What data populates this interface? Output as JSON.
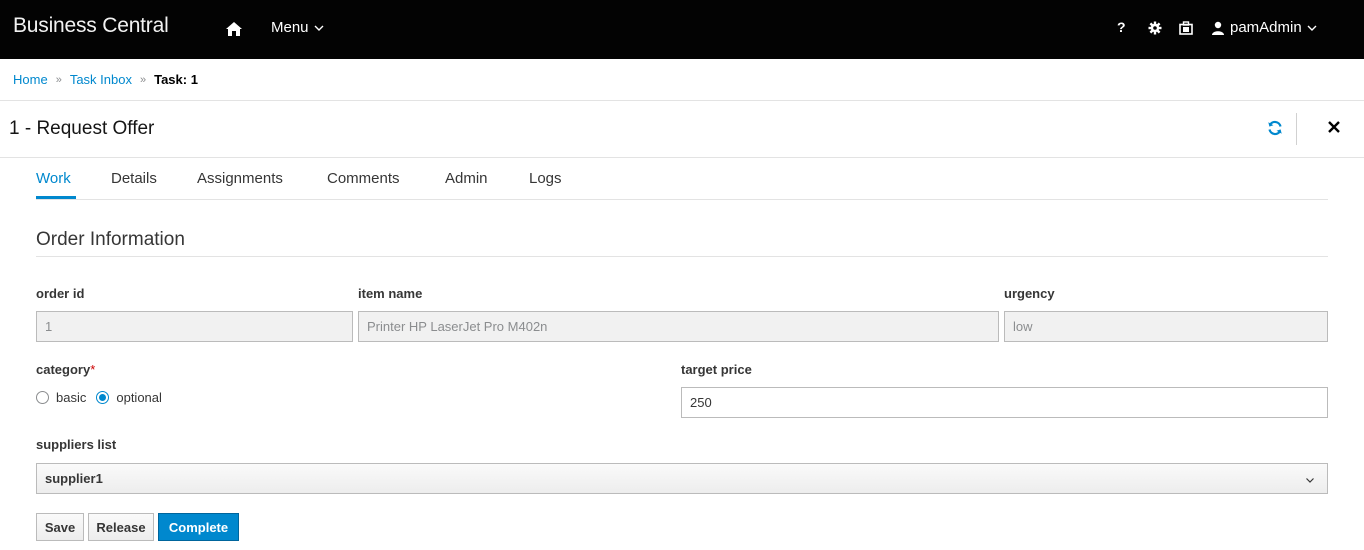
{
  "topbar": {
    "brand": "Business Central",
    "menu_label": "Menu",
    "help_label": "?",
    "user_label": "pamAdmin"
  },
  "breadcrumb": {
    "items": [
      "Home",
      "Task Inbox"
    ],
    "current": "Task: 1",
    "separator": "»"
  },
  "page": {
    "title": "1 - Request Offer"
  },
  "tabs": [
    {
      "label": "Work",
      "active": true
    },
    {
      "label": "Details"
    },
    {
      "label": "Assignments"
    },
    {
      "label": "Comments"
    },
    {
      "label": "Admin"
    },
    {
      "label": "Logs"
    }
  ],
  "form": {
    "section_title": "Order Information",
    "order_id": {
      "label": "order id",
      "value": "1"
    },
    "item_name": {
      "label": "item name",
      "value": "Printer HP LaserJet Pro M402n"
    },
    "urgency": {
      "label": "urgency",
      "value": "low"
    },
    "category": {
      "label": "category",
      "required_mark": "*",
      "options": [
        "basic",
        "optional"
      ],
      "selected": "optional"
    },
    "target_price": {
      "label": "target price",
      "value": "250"
    },
    "suppliers_list": {
      "label": "suppliers list",
      "selected": "supplier1"
    }
  },
  "actions": {
    "save": "Save",
    "release": "Release",
    "complete": "Complete"
  },
  "colors": {
    "accent": "#0088ce",
    "topbar": "#030303",
    "required": "#cc0000"
  }
}
